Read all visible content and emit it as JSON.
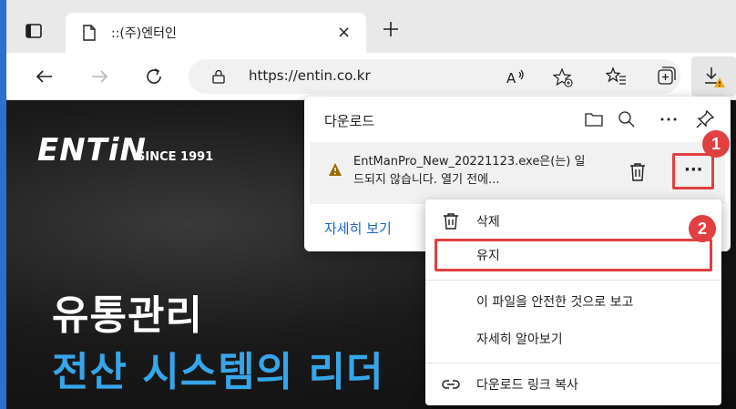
{
  "tab": {
    "title": "::(주)엔터인",
    "close_glyph": "×",
    "new_tab_icon": "plus-icon"
  },
  "address_bar": {
    "url": "https://entin.co.kr",
    "read_aloud_icon": "read-aloud-icon",
    "favorite_icon": "add-favorite-icon",
    "favorites_icon": "favorites-icon",
    "collections_icon": "collections-icon",
    "downloads_icon": "downloads-warning-icon"
  },
  "page": {
    "logo_text": "ENTiN",
    "logo_since": "SINCE 1991",
    "headline_line1": "유통관리",
    "headline_line2": "전산 시스템의 리더",
    "headline_line2_color": "#36a6ea"
  },
  "downloads_panel": {
    "title": "다운로드",
    "header_icons": [
      "open-folder-icon",
      "search-icon",
      "more-icon",
      "pin-icon"
    ],
    "item": {
      "warning_icon": "warning-icon",
      "filename_line1": "EntManPro_New_20221123.exe은(는) 일",
      "filename_line2": "드되지 않습니다. 열기 전에...",
      "delete_icon": "trash-icon",
      "more_label": "···"
    },
    "see_more_link": "자세히 보기"
  },
  "context_menu": {
    "items": [
      {
        "label": "삭제",
        "icon": "trash-icon"
      },
      {
        "label": "유지",
        "icon": ""
      },
      {
        "label": "이 파일을 안전한 것으로 보고",
        "icon": ""
      },
      {
        "label": "자세히 알아보기",
        "icon": ""
      },
      {
        "label": "다운로드 링크 복사",
        "icon": "link-icon"
      }
    ]
  },
  "annotations": {
    "badge_1": "1",
    "badge_2": "2",
    "highlight_color": "#e04040"
  }
}
